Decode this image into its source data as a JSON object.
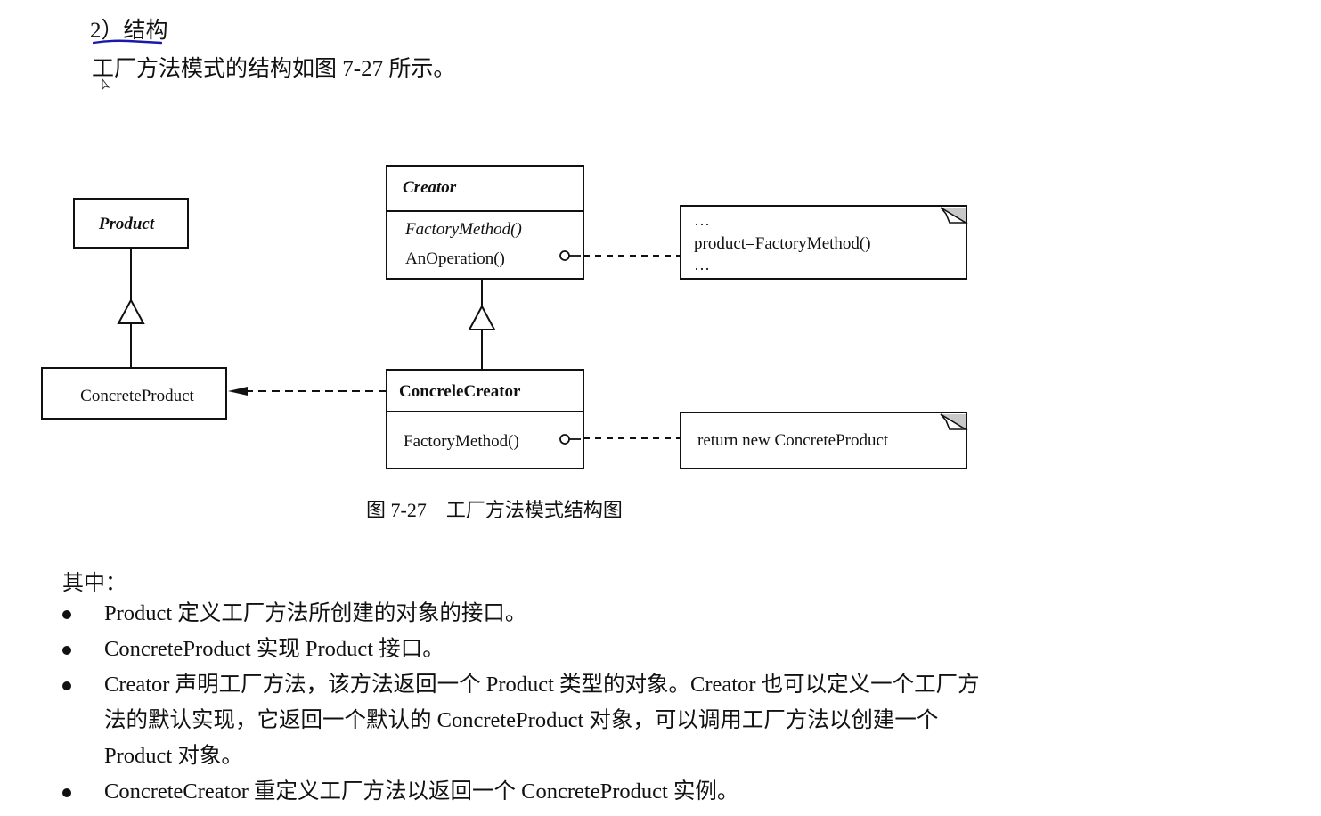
{
  "section": {
    "heading": "2）结构",
    "intro": "工厂方法模式的结构如图 7-27 所示。"
  },
  "diagram": {
    "classes": {
      "product": {
        "name": "Product"
      },
      "concrete_product": {
        "name": "ConcreteProduct"
      },
      "creator": {
        "name": "Creator",
        "methods": [
          "FactoryMethod()",
          "AnOperation()"
        ]
      },
      "concrete_creator": {
        "name": "ConcreleCreator",
        "methods": [
          "FactoryMethod()"
        ]
      }
    },
    "notes": {
      "creator_note": [
        "…",
        "product=FactoryMethod()",
        "…"
      ],
      "concrete_creator_note": [
        "return new ConcreteProduct"
      ]
    },
    "caption": "图 7-27　工厂方法模式结构图"
  },
  "body": {
    "label": "其中：",
    "bullets": [
      "Product 定义工厂方法所创建的对象的接口。",
      "ConcreteProduct 实现 Product 接口。",
      "Creator 声明工厂方法，该方法返回一个 Product 类型的对象。Creator 也可以定义一个工厂方法的默认实现，它返回一个默认的 ConcreteProduct 对象，可以调用工厂方法以创建一个 Product 对象。",
      "ConcreteCreator 重定义工厂方法以返回一个 ConcreteProduct 实例。"
    ]
  },
  "colors": {
    "annotation_underline": "#1a1aa8",
    "note_fold": "#c8c8c8",
    "ink": "#111111"
  }
}
